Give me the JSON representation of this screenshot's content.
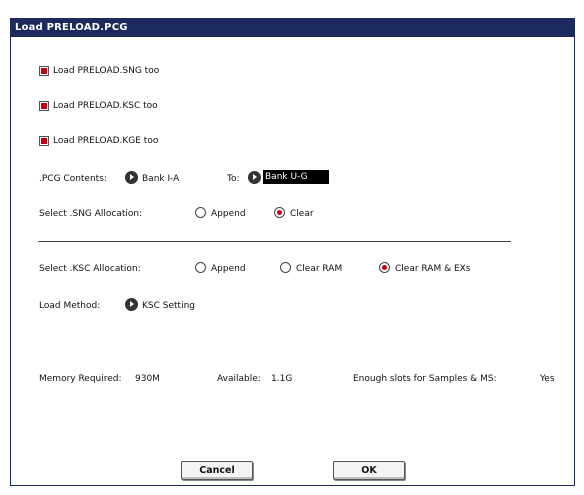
{
  "window": {
    "title": "Load PRELOAD.PCG"
  },
  "options": [
    {
      "label": "Load PRELOAD.SNG too",
      "checked": true
    },
    {
      "label": "Load PRELOAD.KSC too",
      "checked": true
    },
    {
      "label": "Load PRELOAD.KGE too",
      "checked": true
    }
  ],
  "pcg_contents": {
    "label": ".PCG Contents:",
    "from_value": "Bank I-A",
    "to_label": "To:",
    "to_value": "Bank U-G"
  },
  "sng_allocation": {
    "label": "Select .SNG Allocation:",
    "options": [
      "Append",
      "Clear"
    ],
    "selected": "Clear"
  },
  "ksc_allocation": {
    "label": "Select .KSC Allocation:",
    "options": [
      "Append",
      "Clear RAM",
      "Clear RAM & EXs"
    ],
    "selected": "Clear RAM & EXs"
  },
  "load_method": {
    "label": "Load Method:",
    "value": "KSC Setting"
  },
  "memory": {
    "required_label": "Memory Required:",
    "required_value": "930M",
    "available_label": "Available:",
    "available_value": "1.1G",
    "slots_label": "Enough slots for Samples & MS:",
    "slots_value": "Yes"
  },
  "buttons": {
    "cancel": "Cancel",
    "ok": "OK"
  },
  "colors": {
    "titlebar": "#1c2a5e",
    "accent": "#c40010"
  }
}
